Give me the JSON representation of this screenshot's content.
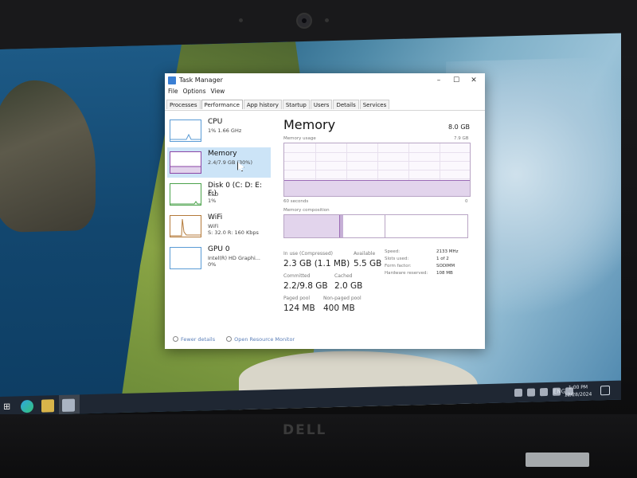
{
  "window": {
    "title": "Task Manager",
    "minimize_glyph": "–",
    "maximize_glyph": "☐",
    "close_glyph": "✕"
  },
  "menu": [
    "File",
    "Options",
    "View"
  ],
  "tabs": [
    "Processes",
    "Performance",
    "App history",
    "Startup",
    "Users",
    "Details",
    "Services"
  ],
  "active_tab": "Performance",
  "sidebar": [
    {
      "name": "CPU",
      "sub1": "1% 1.66 GHz",
      "sub2": ""
    },
    {
      "name": "Memory",
      "sub1": "2.4/7.9 GB (30%)",
      "sub2": ""
    },
    {
      "name": "Disk 0 (C: D: E: F:)",
      "sub1": "SSD",
      "sub2": "1%"
    },
    {
      "name": "WiFi",
      "sub1": "WiFi",
      "sub2": "S: 32.0 R: 160 Kbps"
    },
    {
      "name": "GPU 0",
      "sub1": "Intel(R) HD Graphi...",
      "sub2": "0%"
    }
  ],
  "memory": {
    "title": "Memory",
    "capacity": "8.0 GB",
    "usage_label": "Memory usage",
    "usage_max": "7.9 GB",
    "time_label": "60 seconds",
    "time_end": "0",
    "composition_label": "Memory composition",
    "usage_fraction": 0.3,
    "stats": {
      "in_use_label": "In use (Compressed)",
      "in_use": "2.3 GB (1.1 MB)",
      "available_label": "Available",
      "available": "5.5 GB",
      "committed_label": "Committed",
      "committed": "2.2/9.8 GB",
      "cached_label": "Cached",
      "cached": "2.0 GB",
      "paged_label": "Paged pool",
      "paged": "124 MB",
      "nonpaged_label": "Non-paged pool",
      "nonpaged": "400 MB"
    },
    "specs": {
      "speed_label": "Speed:",
      "speed": "2133 MHz",
      "slots_label": "Slots used:",
      "slots": "1 of 2",
      "form_label": "Form factor:",
      "form": "SODIMM",
      "reserved_label": "Hardware reserved:",
      "reserved": "108 MB"
    }
  },
  "footer": {
    "fewer": "Fewer details",
    "resmon": "Open Resource Monitor"
  },
  "taskbar": {
    "lang": "ENG",
    "time": "1:00 PM",
    "date": "12/28/2024"
  },
  "brand": "DELL"
}
